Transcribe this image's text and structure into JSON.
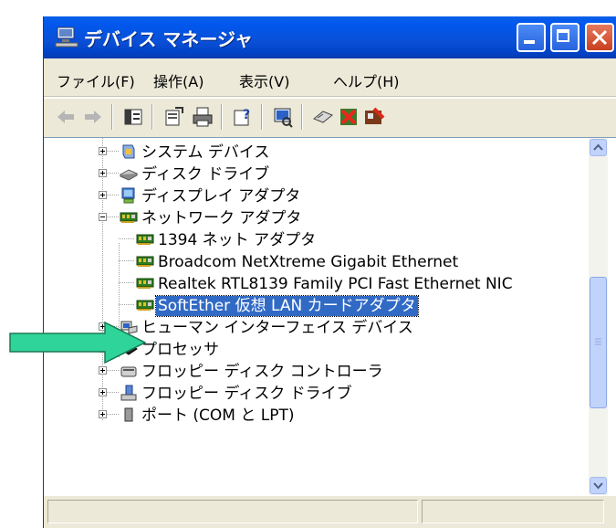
{
  "window": {
    "title": "デバイス マネージャ",
    "controls": {
      "minimize": "minimize",
      "maximize": "maximize",
      "close": "close"
    }
  },
  "menu": [
    {
      "label": "ファイル(F)"
    },
    {
      "label": "操作(A)"
    },
    {
      "label": "表示(V)"
    },
    {
      "label": "ヘルプ(H)"
    }
  ],
  "toolbar": {
    "buttons": [
      "back-arrow",
      "forward-arrow",
      "show-hide-console-tree",
      "properties",
      "print",
      "help",
      "scan-hardware-changes",
      "disable-device",
      "uninstall-device",
      "update-driver"
    ]
  },
  "tree": {
    "items": [
      {
        "label": "システム デバイス",
        "icon": "system-device-icon",
        "expander": "plus"
      },
      {
        "label": "ディスク ドライブ",
        "icon": "disk-drive-icon",
        "expander": "plus"
      },
      {
        "label": "ディスプレイ アダプタ",
        "icon": "display-adapter-icon",
        "expander": "plus"
      },
      {
        "label": "ネットワーク アダプタ",
        "icon": "network-adapter-icon",
        "expander": "minus"
      },
      {
        "label": "1394 ネット アダプタ",
        "icon": "network-card-icon",
        "child": true
      },
      {
        "label": "Broadcom NetXtreme Gigabit Ethernet",
        "icon": "network-card-icon",
        "child": true
      },
      {
        "label": "Realtek RTL8139 Family PCI Fast Ethernet NIC",
        "icon": "network-card-icon",
        "child": true
      },
      {
        "label": "SoftEther 仮想 LAN カードアダプタ",
        "icon": "network-card-icon",
        "child": true,
        "selected": true
      },
      {
        "label": "ヒューマン インターフェイス デバイス",
        "icon": "hid-icon",
        "expander": "plus"
      },
      {
        "label": "プロセッサ",
        "icon": "processor-icon",
        "expander": "plus"
      },
      {
        "label": "フロッピー ディスク コントローラ",
        "icon": "floppy-controller-icon",
        "expander": "plus"
      },
      {
        "label": "フロッピー ディスク ドライブ",
        "icon": "floppy-drive-icon",
        "expander": "plus"
      },
      {
        "label": "ポート (COM と LPT)",
        "icon": "port-icon",
        "expander": "plus"
      }
    ]
  },
  "colors": {
    "selection": "#316ac5",
    "titlebar": "#0058ee",
    "arrow": "#2fd49a"
  }
}
